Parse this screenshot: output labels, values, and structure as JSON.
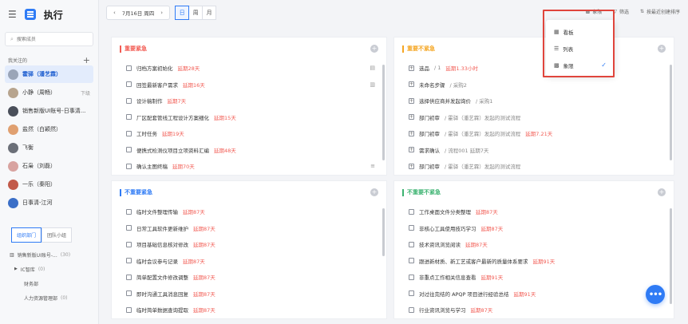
{
  "app": {
    "title": "执行"
  },
  "sidebar": {
    "search_placeholder": "搜索成员",
    "section_label": "我关注的",
    "people": [
      {
        "name": "霍驿（潘艺霖）",
        "active": true,
        "color": "#9aa5b8"
      },
      {
        "name": "小静（周畅）",
        "tag": "下级",
        "color": "#b7a48e"
      },
      {
        "name": "销售新版UI账号-日事清...",
        "color": "#4a4f5a"
      },
      {
        "name": "盐然（白颖然）",
        "color": "#e0a070"
      },
      {
        "name": "飞衡",
        "color": "#6b6f78"
      },
      {
        "name": "石枭（刘磊）",
        "color": "#d8a3a0"
      },
      {
        "name": "一乐（秦阳）",
        "color": "#c25a4a"
      },
      {
        "name": "日事清-江河",
        "color": "#3b6fc7"
      }
    ],
    "tabs": [
      "组织部门",
      "团队小组"
    ],
    "org": {
      "root_name": "销售新版UI账号-...",
      "root_count": "(30)",
      "children": [
        {
          "name": "IC智库",
          "count": "(0)"
        },
        {
          "name": "财务部",
          "count": ""
        },
        {
          "name": "人力资源管理部",
          "count": "(0)"
        }
      ]
    }
  },
  "toolbar": {
    "date": "7月16日 周四",
    "views": [
      "日",
      "周",
      "月"
    ],
    "active_view": "日",
    "tools": [
      "象限",
      "筛选",
      "按最近创建排序"
    ]
  },
  "dropdown": {
    "items": [
      {
        "label": "看板",
        "icon": "▦"
      },
      {
        "label": "列表",
        "icon": "☰"
      },
      {
        "label": "象限",
        "icon": "▩",
        "checked": true
      }
    ]
  },
  "quadrants": {
    "q1": {
      "title": "重要紧急",
      "color": "#f25c54",
      "tasks": [
        {
          "text": "归档方案初始化",
          "overdue": "延期28天",
          "icon": "▤"
        },
        {
          "text": "回签最新客户需求",
          "overdue": "延期16天",
          "icon": "▥"
        },
        {
          "text": "设计稿制作",
          "overdue": "延期7天",
          "icon": ""
        },
        {
          "text": "厂区配套管线工程设计方案细化",
          "overdue": "延期15天",
          "icon": ""
        },
        {
          "text": "工时任务",
          "overdue": "延期19天",
          "icon": ""
        },
        {
          "text": "便携式检测仪项目立项资料汇编",
          "overdue": "延期48天",
          "icon": ""
        },
        {
          "text": "确认主图终稿",
          "overdue": "延期70天",
          "icon": "≡"
        }
      ]
    },
    "q2": {
      "title": "重要不紧急",
      "color": "#f5a623",
      "tasks": [
        {
          "text": "选品",
          "muted": " / 1",
          "overdue": " 延期1.33小时"
        },
        {
          "text": "未命名步骤",
          "muted": " / 采购2"
        },
        {
          "text": "选择供应商并发起询价",
          "muted": " / 采购1"
        },
        {
          "text": "部门初审",
          "muted": " / 霍驿（潘艺霖）发起的测试流程"
        },
        {
          "text": "部门初审",
          "muted": " / 霍驿（潘艺霖）发起的测试流程",
          "overdue": " 延期7.21天"
        },
        {
          "text": "需求确认",
          "muted": " / 流程001 延期7天"
        },
        {
          "text": "部门初审",
          "muted": " / 霍驿（潘艺霖）发起的测试流程"
        }
      ]
    },
    "q3": {
      "title": "不重要紧急",
      "color": "#2f7bf5",
      "tasks": [
        {
          "text": "临时文件整理传输",
          "overdue": "延期87天"
        },
        {
          "text": "日常工具软件更新维护",
          "overdue": "延期87天"
        },
        {
          "text": "项目基础信息核对修改",
          "overdue": "延期87天"
        },
        {
          "text": "临时会议参与记录",
          "overdue": "延期87天"
        },
        {
          "text": "简单配置文件修改调整",
          "overdue": "延期87天"
        },
        {
          "text": "即时沟通工具消息回复",
          "overdue": "延期87天"
        },
        {
          "text": "临时简单数据查询提取",
          "overdue": "延期87天"
        }
      ]
    },
    "q4": {
      "title": "不重要不紧急",
      "color": "#3cb371",
      "tasks": [
        {
          "text": "工作桌面文件分类整理",
          "overdue": "延期87天"
        },
        {
          "text": "非核心工具使用技巧学习",
          "overdue": "延期87天"
        },
        {
          "text": "技术资讯浏览阅读",
          "overdue": "延期87天"
        },
        {
          "text": "跟进新材质、新工艺或客户最新的质量体系要求",
          "overdue": "延期91天"
        },
        {
          "text": "非重点工作相关信息查看",
          "overdue": "延期91天"
        },
        {
          "text": "对过往完结的 APQP 项目进行经验总结",
          "overdue": "延期91天"
        },
        {
          "text": "行业资讯浏览与学习",
          "overdue": "延期87天"
        }
      ]
    }
  }
}
